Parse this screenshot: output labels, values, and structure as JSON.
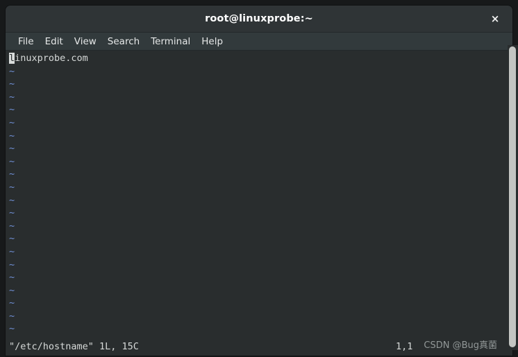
{
  "window": {
    "title": "root@linuxprobe:~",
    "close_label": "×",
    "bg_color": "#292d2e",
    "titlebar_color": "#2f3436",
    "menubar_color": "#323a3c"
  },
  "menubar": {
    "items": [
      {
        "label": "File"
      },
      {
        "label": "Edit"
      },
      {
        "label": "View"
      },
      {
        "label": "Search"
      },
      {
        "label": "Terminal"
      },
      {
        "label": "Help"
      }
    ]
  },
  "terminal": {
    "editor": "vim",
    "cursor_char": "l",
    "first_line_rest": "inuxprobe.com",
    "tilde_char": "~",
    "tilde_rows": 22,
    "tilde_color": "#6f8fd4",
    "text_color": "#d6d9d8",
    "cursor_bg": "#d9dcdb"
  },
  "statusline": {
    "file_info": "\"/etc/hostname\" 1L, 15C",
    "ruler": "1,1"
  },
  "watermark": {
    "text": "CSDN @Bug真菌"
  },
  "scrollbar": {
    "thumb_color": "#c4c6c3"
  }
}
